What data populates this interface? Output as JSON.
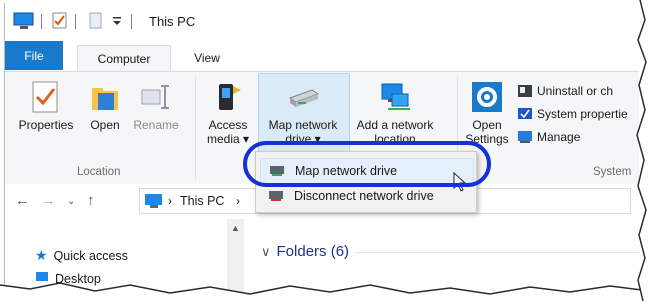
{
  "window": {
    "title": "This PC"
  },
  "tabs": [
    {
      "label": "File"
    },
    {
      "label": "Computer"
    },
    {
      "label": "View"
    }
  ],
  "ribbon": {
    "location": {
      "label": "Location",
      "properties": "Properties",
      "open": "Open",
      "rename": "Rename"
    },
    "network": {
      "access_media_1": "Access",
      "access_media_2": "media ▾",
      "map_drive_1": "Map network",
      "map_drive_2": "drive ▾",
      "add_location_1": "Add a network",
      "add_location_2": "location"
    },
    "system": {
      "label": "System",
      "open_settings_1": "Open",
      "open_settings_2": "Settings",
      "uninstall": "Uninstall or ch",
      "system_properties": "System propertie",
      "manage": "Manage"
    }
  },
  "dropdown": {
    "items": [
      {
        "label": "Map network drive"
      },
      {
        "label": "Disconnect network drive"
      }
    ]
  },
  "address": {
    "path": "This PC",
    "sep": "›"
  },
  "navpane": {
    "quick_access": "Quick access",
    "desktop": "Desktop"
  },
  "content": {
    "folders_header": "Folders (6)"
  }
}
